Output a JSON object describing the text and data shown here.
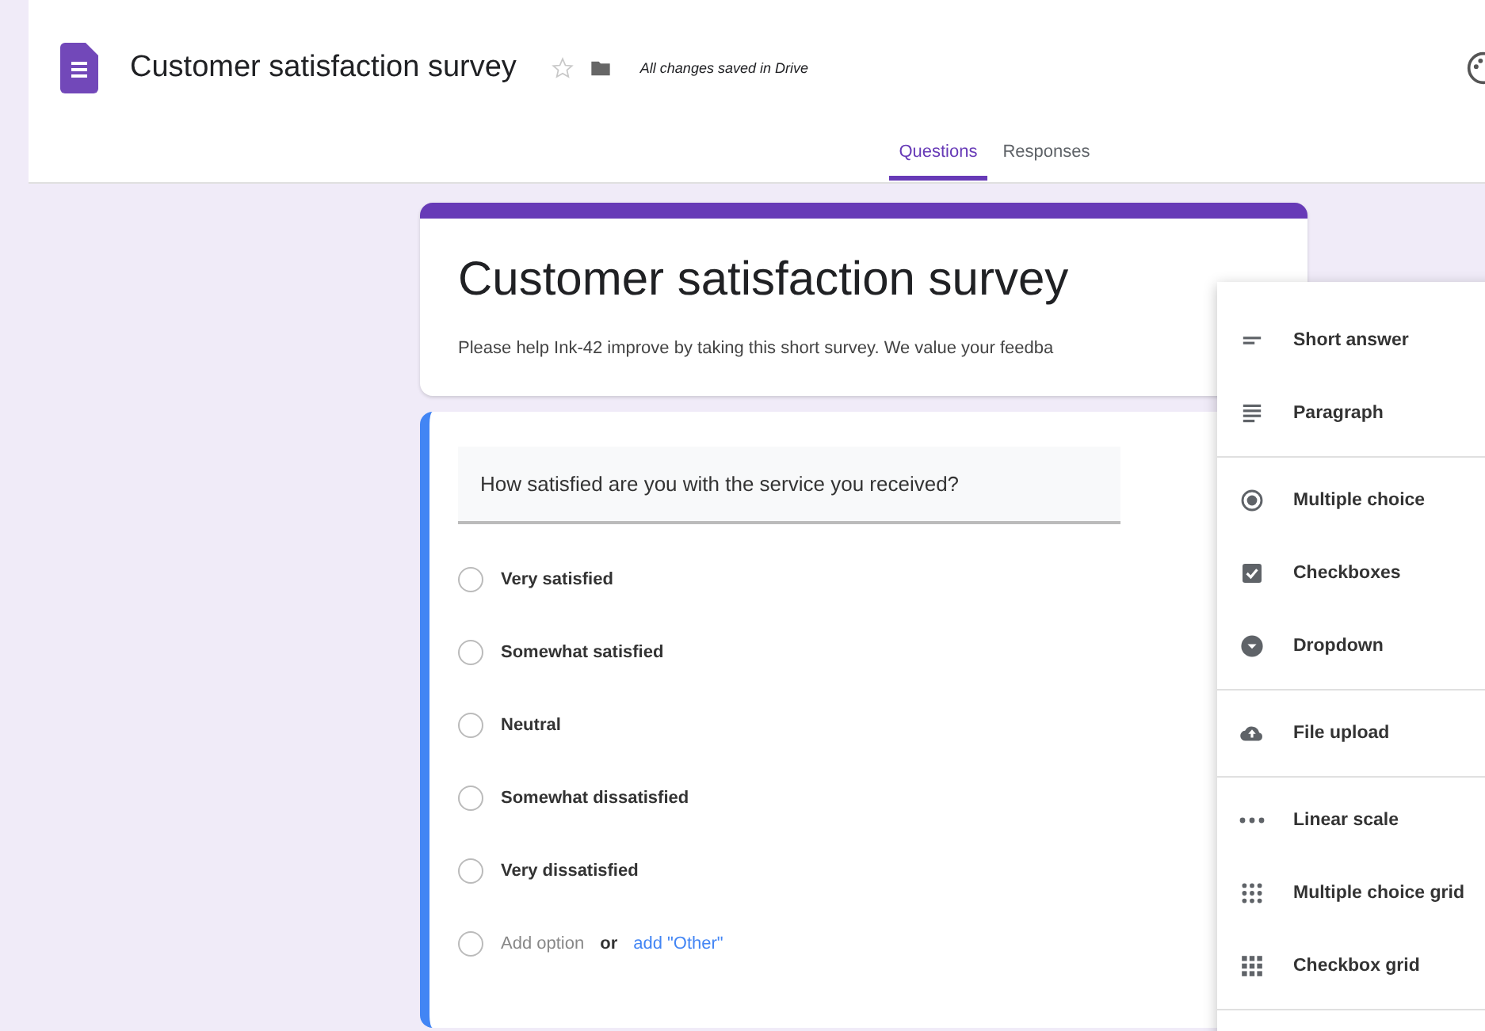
{
  "header": {
    "title": "Customer satisfaction survey",
    "starred": false,
    "save_status": "All changes saved in Drive"
  },
  "tabs": [
    {
      "label": "Questions",
      "selected": true
    },
    {
      "label": "Responses",
      "selected": false
    }
  ],
  "form": {
    "title": "Customer satisfaction survey",
    "description": "Please help Ink-42 improve by taking this short survey. We value your feedba"
  },
  "question": {
    "text": "How satisfied are you with the service you received?",
    "options": [
      {
        "label": "Very satisfied",
        "selected": false
      },
      {
        "label": "Somewhat satisfied",
        "selected": false
      },
      {
        "label": "Neutral",
        "selected": false
      },
      {
        "label": "Somewhat dissatisfied",
        "selected": false
      },
      {
        "label": "Very dissatisfied",
        "selected": false
      }
    ],
    "add_option": "Add option",
    "or": "or",
    "add_other": "add \"Other\""
  },
  "type_menu": [
    [
      "Short answer",
      "Paragraph"
    ],
    [
      "Multiple choice",
      "Checkboxes",
      "Dropdown"
    ],
    [
      "File upload"
    ],
    [
      "Linear scale",
      "Multiple choice grid",
      "Checkbox grid"
    ]
  ]
}
